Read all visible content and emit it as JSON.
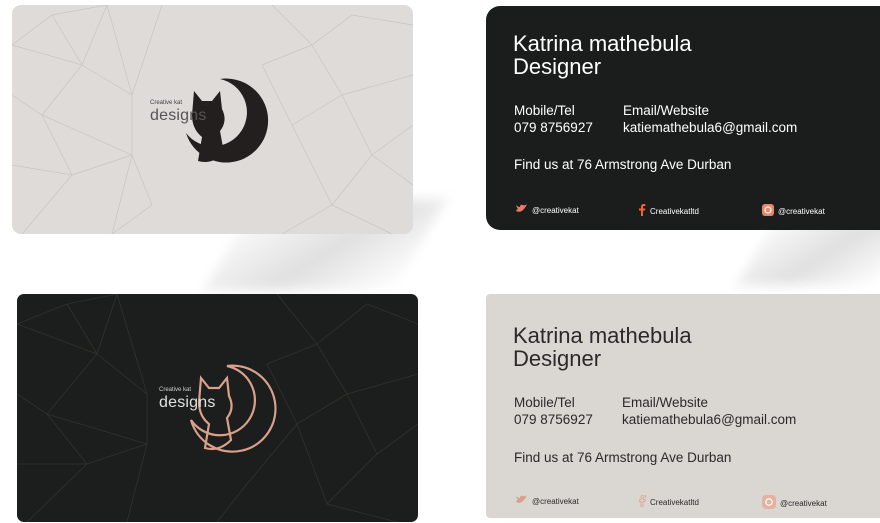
{
  "logo": {
    "small_text": "Creative kat",
    "big_text": "designs"
  },
  "info_card": {
    "name": "Katrina mathebula",
    "role": "Designer",
    "mobile_label": "Mobile/Tel",
    "mobile_value": "079 8756927",
    "email_label": "Email/Website",
    "email_value": "katiemathebula6@gmail.com",
    "address": "Find us at 76 Armstrong Ave Durban",
    "socials": [
      {
        "icon": "twitter-icon",
        "text": "@creativekat"
      },
      {
        "icon": "facebook-icon",
        "text": "Creativekatltd"
      },
      {
        "icon": "instagram-icon",
        "text": "@creativekat"
      }
    ]
  },
  "colors": {
    "light_card": "#dedbd8",
    "dark_card": "#1b1d1c",
    "rose_gold": "#d9a08b",
    "twitter_blue": "#e87b61",
    "facebook_orange": "#f0643c"
  }
}
